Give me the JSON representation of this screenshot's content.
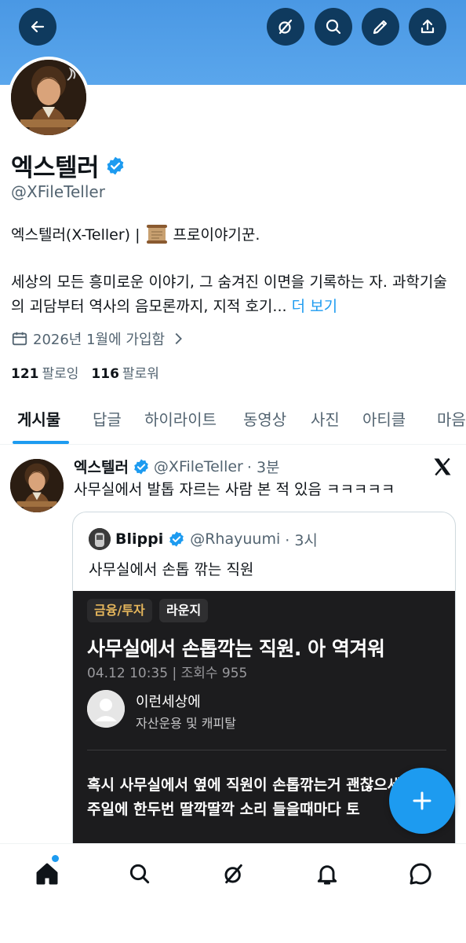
{
  "header": {
    "back_icon": "arrow-left-icon",
    "actions": [
      "grok-icon",
      "search-icon",
      "edit-icon",
      "share-icon"
    ]
  },
  "profile": {
    "display_name": "엑스텔러",
    "handle": "@XFileTeller",
    "bio_line1_pre": "엑스텔러(X-Teller) |",
    "bio_emoji": "scroll-icon",
    "bio_line1_post": "프로이야기꾼.",
    "bio_line2": "세상의 모든 흥미로운 이야기, 그 숨겨진 이면을 기록하는 자. 과학기술의 괴담부터 역사의 음모론까지, 지적 호기...",
    "more_label": "더 보기",
    "joined": "2026년 1월에 가입함",
    "following_count": "121",
    "following_label": "팔로잉",
    "followers_count": "116",
    "followers_label": "팔로워"
  },
  "tabs": [
    "게시물",
    "답글",
    "하이라이트",
    "동영상",
    "사진",
    "아티클",
    "마음"
  ],
  "post": {
    "author": "엑스텔러",
    "handle": "@XFileTeller",
    "time": "· 3분",
    "text": "사무실에서 발톱 자르는 사람 본 적 있음 ㅋㅋㅋㅋㅋ",
    "quote": {
      "author": "Blippi",
      "handle": "@Rhayuumi",
      "time": "· 3시",
      "text": "사무실에서 손톱 깎는 직원",
      "embed": {
        "tag1": "금융/투자",
        "tag2": "라운지",
        "title": "사무실에서 손톱깍는 직원. 아 역겨워",
        "meta": "04.12 10:35 | 조회수 955",
        "user_name": "이런세상에",
        "user_sub": "자산운용 및 캐피탈",
        "body": "혹시 사무실에서 옆에 직원이 손톱깎는거 괜찮으세요? 일주일에 한두번 딸깍딸깍 소리 들을때마다 토"
      }
    }
  },
  "colors": {
    "accent": "#1d9bf0",
    "banner": "#4a98e4",
    "header_button": "#0f3a5e",
    "embed_bg": "#1c1c1e",
    "tag_gold": "#e5b65c"
  },
  "nav": [
    "home-icon",
    "search-icon",
    "grok-icon",
    "notifications-icon",
    "messages-icon"
  ]
}
